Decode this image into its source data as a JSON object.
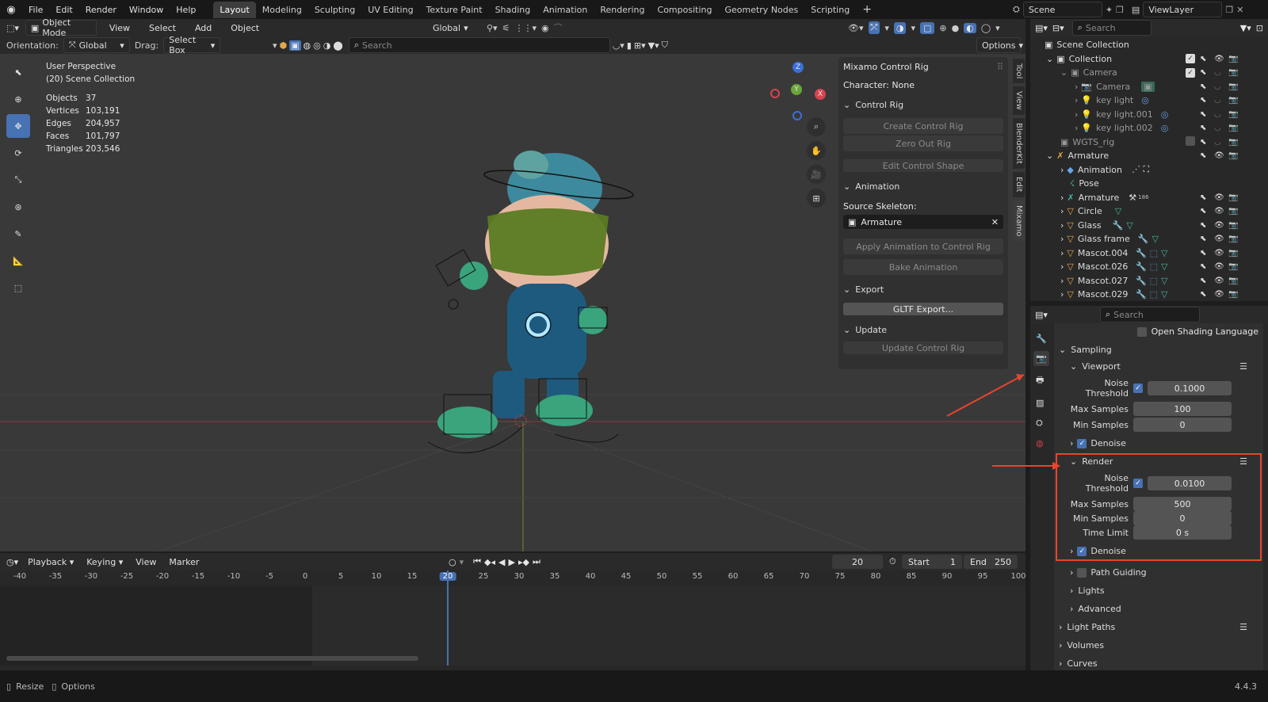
{
  "topbar": {
    "menus": [
      "File",
      "Edit",
      "Render",
      "Window",
      "Help"
    ],
    "workspaces": [
      "Layout",
      "Modeling",
      "Sculpting",
      "UV Editing",
      "Texture Paint",
      "Shading",
      "Animation",
      "Rendering",
      "Compositing",
      "Geometry Nodes",
      "Scripting"
    ],
    "active_workspace": "Layout",
    "add_tab": "+",
    "scene": "Scene",
    "view_layer": "ViewLayer"
  },
  "viewport_header": {
    "mode": "Object Mode",
    "menus": [
      "View",
      "Select",
      "Add",
      "Object"
    ],
    "transform": "Global",
    "orientation_label": "Orientation:",
    "orientation_value": "Global",
    "drag_label": "Drag:",
    "drag_value": "Select Box",
    "search_placeholder": "Search",
    "options": "Options"
  },
  "overlay": {
    "title": "User Perspective",
    "subtitle": "(20) Scene Collection",
    "stats": [
      {
        "label": "Objects",
        "value": "37"
      },
      {
        "label": "Vertices",
        "value": "103,191"
      },
      {
        "label": "Edges",
        "value": "204,957"
      },
      {
        "label": "Faces",
        "value": "101,797"
      },
      {
        "label": "Triangles",
        "value": "203,546"
      }
    ]
  },
  "gizmo": {
    "z": "Z",
    "y": "Y",
    "x": "X"
  },
  "mixamo": {
    "title": "Mixamo Control Rig",
    "character": "Character: None",
    "control_rig": "Control Rig",
    "create": "Create Control Rig",
    "zero": "Zero Out Rig",
    "edit_shape": "Edit Control Shape",
    "animation": "Animation",
    "source_label": "Source Skeleton:",
    "source_value": "Armature",
    "apply": "Apply Animation to Control Rig",
    "bake": "Bake Animation",
    "export": "Export",
    "gltf": "GLTF Export...",
    "update": "Update",
    "update_btn": "Update Control Rig"
  },
  "side_tabs": [
    "Tool",
    "View",
    "BlenderKit",
    "Edit",
    "Mixamo"
  ],
  "outliner": {
    "search_placeholder": "Search",
    "rows": [
      {
        "label": "Scene Collection",
        "indent": 0
      },
      {
        "label": "Collection",
        "indent": 1
      },
      {
        "label": "Camera",
        "indent": 2
      },
      {
        "label": "Camera",
        "indent": 3
      },
      {
        "label": "key light",
        "indent": 3
      },
      {
        "label": "key light.001",
        "indent": 3
      },
      {
        "label": "key light.002",
        "indent": 3
      },
      {
        "label": "WGTS_rig",
        "indent": 1
      },
      {
        "label": "Armature",
        "indent": 1
      },
      {
        "label": "Animation",
        "indent": 2
      },
      {
        "label": "Pose",
        "indent": 2
      },
      {
        "label": "Armature",
        "indent": 2
      },
      {
        "label": "Circle",
        "indent": 2
      },
      {
        "label": "Glass",
        "indent": 2
      },
      {
        "label": "Glass frame",
        "indent": 2
      },
      {
        "label": "Mascot.004",
        "indent": 2
      },
      {
        "label": "Mascot.026",
        "indent": 2
      },
      {
        "label": "Mascot.027",
        "indent": 2
      },
      {
        "label": "Mascot.029",
        "indent": 2
      }
    ],
    "badge": "186"
  },
  "properties": {
    "search_placeholder": "Search",
    "osl": "Open Shading Language",
    "sampling": "Sampling",
    "viewport": "Viewport",
    "vp_noise_label": "Noise Threshold",
    "vp_noise_value": "0.1000",
    "vp_max_label": "Max Samples",
    "vp_max_value": "100",
    "vp_min_label": "Min Samples",
    "vp_min_value": "0",
    "denoise": "Denoise",
    "render": "Render",
    "r_noise_label": "Noise Threshold",
    "r_noise_value": "0.0100",
    "r_max_label": "Max Samples",
    "r_max_value": "500",
    "r_min_label": "Min Samples",
    "r_min_value": "0",
    "time_label": "Time Limit",
    "time_value": "0 s",
    "r_denoise": "Denoise",
    "path_guiding": "Path Guiding",
    "lights": "Lights",
    "advanced": "Advanced",
    "light_paths": "Light Paths",
    "volumes": "Volumes",
    "curves": "Curves"
  },
  "timeline": {
    "menus": [
      "Playback",
      "Keying",
      "View",
      "Marker"
    ],
    "current": "20",
    "start_label": "Start",
    "start_value": "1",
    "end_label": "End",
    "end_value": "250",
    "ticks": [
      "-40",
      "-35",
      "-30",
      "-25",
      "-20",
      "-15",
      "-10",
      "-5",
      "0",
      "5",
      "10",
      "15",
      "20",
      "25",
      "30",
      "35",
      "40",
      "45",
      "50",
      "55",
      "60",
      "65",
      "70",
      "75",
      "80",
      "85",
      "90",
      "95",
      "100"
    ]
  },
  "statusbar": {
    "resize": "Resize",
    "options": "Options",
    "version": "4.4.3"
  },
  "colors": {
    "accent": "#4772b3",
    "annotation": "#e8452c",
    "bg": "#1d1d1d",
    "panel": "#303030"
  }
}
